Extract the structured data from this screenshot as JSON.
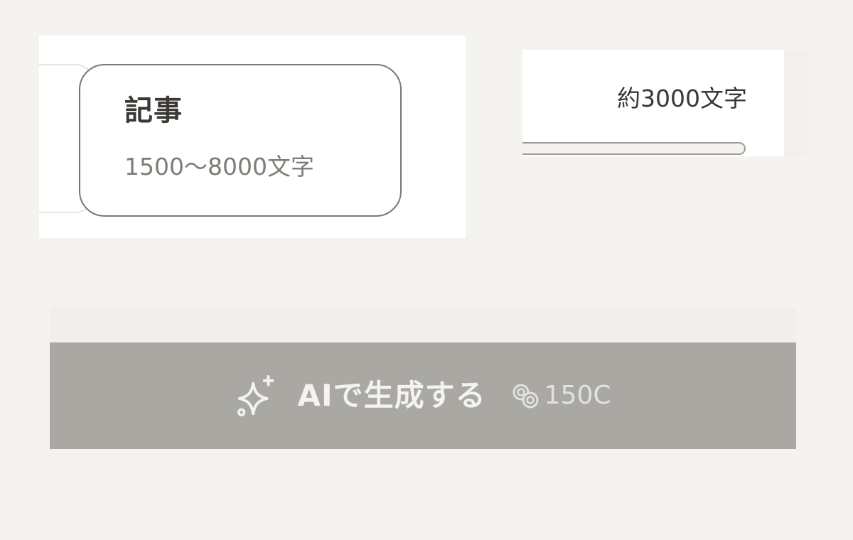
{
  "options": {
    "selected_card": {
      "title": "記事",
      "range": "1500〜8000文字"
    }
  },
  "length": {
    "estimate_label": "約3000文字"
  },
  "generate": {
    "label": "AIで生成する",
    "cost": "150C",
    "icon": "sparkle-icon",
    "cost_icon": "coin-icon",
    "disabled": true
  },
  "colors": {
    "page_background": "#f4f3ef",
    "button_background": "#a9a8a3",
    "card_border_selected": "#7b7873",
    "text_primary": "#3a3734",
    "text_secondary": "#807c77"
  }
}
